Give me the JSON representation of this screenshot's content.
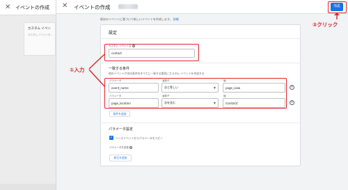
{
  "background_page": {
    "title": "イベントの作成",
    "card_title": "カスタム イベン",
    "card_subtitle": "カスタム イベントを..."
  },
  "header": {
    "title": "イベントの作成",
    "create_button": "作成"
  },
  "intro": {
    "text": "既存のイベントに基づいて新しいイベントを作成します。",
    "link": "詳細"
  },
  "settings": {
    "heading": "設定",
    "custom_event_name_label": "カスタム イベント名",
    "custom_event_name_value": "contact"
  },
  "conditions": {
    "title": "一致する条件",
    "description": "他のイベントが次の条件のすべてに一致する場合にカスタム イベントを作成する",
    "param_label": "パラメータ",
    "operator_label": "演算子",
    "value_label": "値",
    "rows": [
      {
        "param": "event_name",
        "operator": "次と等しい",
        "value": "page_view"
      },
      {
        "param": "page_location",
        "operator": "次を含む",
        "value": "/contact/"
      }
    ],
    "add_condition": "条件を追加"
  },
  "param_config": {
    "title": "パラメータ設定",
    "copy_checkbox_label": "ソースイベントからパラメータをコピー",
    "modify_label": "パラメータを変更",
    "add_modification": "修正を追加"
  },
  "annotations": {
    "input": "①入力",
    "click": "②クリック"
  },
  "colors": {
    "accent": "#1a73e8",
    "annotation": "#e3202a"
  }
}
